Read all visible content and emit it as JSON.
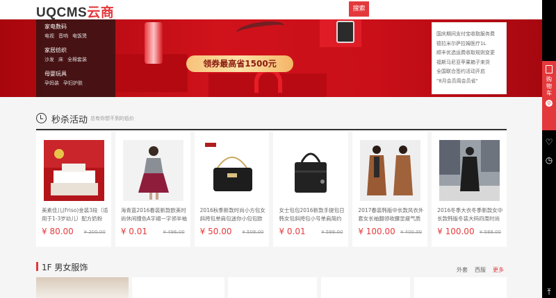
{
  "header": {
    "logo_prefix": "UQCMS",
    "logo_suffix": "云商",
    "search_button": "搜索"
  },
  "banner": {
    "coupon_text": "领券最高省1500元",
    "dots": 3,
    "categories": [
      {
        "title": "家电数码",
        "links": [
          "电视",
          "音响",
          "电饭煲"
        ]
      },
      {
        "title": "家居纺织",
        "links": [
          "沙发",
          "床",
          "全棉套装"
        ]
      },
      {
        "title": "母婴玩具",
        "links": [
          "孕妈装",
          "孕妇护肤"
        ]
      }
    ],
    "news": [
      "国庆期间支付宝收取服务费",
      "德拉米尔萨拉姆医疗1L",
      "顺丰优选运费收取规则变更",
      "福斯马尼亚苹果箱子来货",
      "全国联合签约活动开启",
      "\"8月会员周会员省\""
    ]
  },
  "sidebar": {
    "cart_label": "购物车",
    "cart_count": "0"
  },
  "seckill": {
    "title": "秒杀活动",
    "subtitle": "总有你想不到的低价",
    "products": [
      {
        "name": "美素佳儿(Friso)金装3段（适用于1-3岁幼儿）配方奶粉 京",
        "price": "¥ 80.00",
        "old_price": "¥ 200.00",
        "img": "red"
      },
      {
        "name": "海青蓝2016春装新款欧美时尚休闲撞色A字裙一字领半袖连衣",
        "price": "¥ 0.01",
        "old_price": "¥ 496.00",
        "img": "dress"
      },
      {
        "name": "2016秋季新款时尚小方包女斜挎包单肩包迷你小包包欧美百",
        "price": "¥ 50.00",
        "old_price": "¥ 508.00",
        "img": "bag"
      },
      {
        "name": "女士包包2016新款手提包日韩女包斜挎包小号单肩简约质感",
        "price": "¥ 0.01",
        "old_price": "¥ 599.00",
        "img": "handbag"
      },
      {
        "name": "2017春装韩版中长款风衣外套女长袖翻领收腰显瘦气质双排",
        "price": "¥ 100.00",
        "old_price": "¥ 400.00",
        "img": "coat"
      },
      {
        "name": "2016冬季大衣冬季新款女中长款韩版冬装大码四周时尚毛",
        "price": "¥ 100.00",
        "old_price": "¥ 588.00",
        "img": "street"
      }
    ]
  },
  "floor": {
    "title": "1F 男女服饰",
    "tabs": [
      "外套",
      "西服"
    ],
    "more": "更多"
  }
}
